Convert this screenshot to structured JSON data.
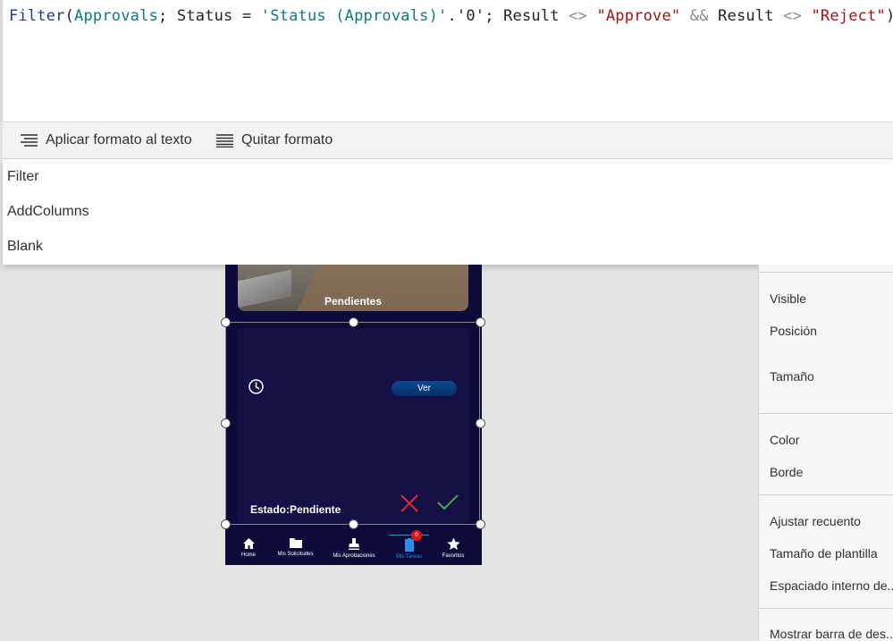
{
  "formula": {
    "tokens": [
      {
        "text": "Filter",
        "kind": "fn"
      },
      {
        "text": "(",
        "kind": "bracket"
      },
      {
        "text": "Approvals",
        "kind": "ident"
      },
      {
        "text": "; Status = ",
        "kind": "plain"
      },
      {
        "text": "'Status (Approvals)'",
        "kind": "ident"
      },
      {
        "text": ".'0'; Result ",
        "kind": "plain"
      },
      {
        "text": "<>",
        "kind": "op"
      },
      {
        "text": " ",
        "kind": "plain"
      },
      {
        "text": "\"Approve\"",
        "kind": "str"
      },
      {
        "text": " ",
        "kind": "plain"
      },
      {
        "text": "&&",
        "kind": "op"
      },
      {
        "text": " Result ",
        "kind": "plain"
      },
      {
        "text": "<>",
        "kind": "op"
      },
      {
        "text": " ",
        "kind": "plain"
      },
      {
        "text": "\"Reject\"",
        "kind": "str"
      },
      {
        "text": ")",
        "kind": "bracket"
      }
    ]
  },
  "toolbar": {
    "format_text_label": "Aplicar formato al texto",
    "remove_format_label": "Quitar formato"
  },
  "suggestions": [
    "Filter",
    "AddColumns",
    "Blank"
  ],
  "canvas": {
    "pending_title": "Pendientes",
    "ver_label": "Ver",
    "estado_text": "Estado:Pendiente",
    "nav": [
      {
        "label": "Home",
        "icon": "home-icon"
      },
      {
        "label": "Mis Solicitudes",
        "icon": "folder-icon"
      },
      {
        "label": "Mis Aprobaciones",
        "icon": "stamp-icon"
      },
      {
        "label": "Mis Tareas",
        "icon": "clipboard-icon",
        "active": true
      },
      {
        "label": "Favoritos",
        "icon": "star-icon"
      }
    ],
    "tasks_badge": "0"
  },
  "properties": [
    "Visible",
    "Posición",
    "Tamaño",
    "Color",
    "Borde",
    "Ajustar recuento",
    "Tamaño de plantilla",
    "Espaciado interno de...",
    "Mostrar barra de des..."
  ],
  "colors": {
    "accent_blue": "#2b8ee8",
    "reject_red": "#e0273a",
    "approve_green": "#3cb043",
    "app_background": "#0d0b3a"
  }
}
